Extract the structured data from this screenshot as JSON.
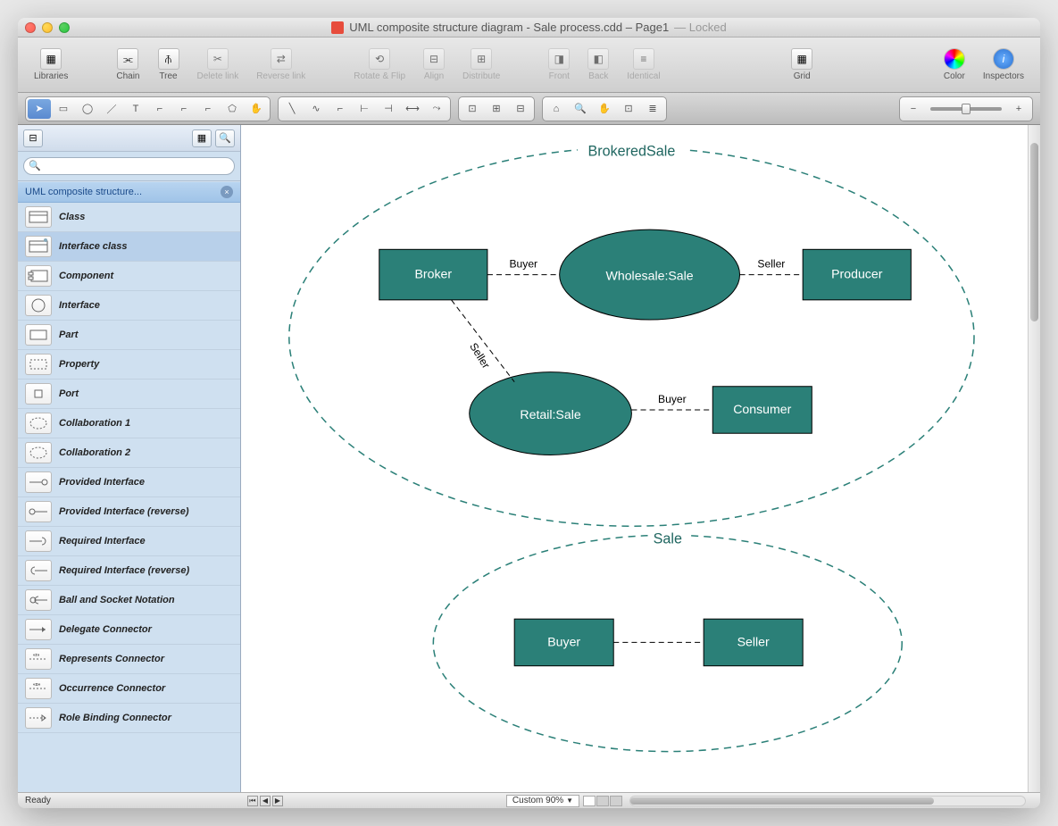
{
  "window": {
    "title": "UML composite structure diagram - Sale process.cdd – Page1",
    "locked_label": "— Locked"
  },
  "toolbar": {
    "libraries": "Libraries",
    "chain": "Chain",
    "tree": "Tree",
    "delete_link": "Delete link",
    "reverse_link": "Reverse link",
    "rotate_flip": "Rotate & Flip",
    "align": "Align",
    "distribute": "Distribute",
    "front": "Front",
    "back": "Back",
    "identical": "Identical",
    "grid": "Grid",
    "color": "Color",
    "inspectors": "Inspectors"
  },
  "sidebar": {
    "search_placeholder": "",
    "library_title": "UML composite structure...",
    "shapes": [
      "Class",
      "Interface class",
      "Component",
      "Interface",
      "Part",
      "Property",
      "Port",
      "Collaboration 1",
      "Collaboration 2",
      "Provided Interface",
      "Provided Interface (reverse)",
      "Required Interface",
      "Required Interface (reverse)",
      "Ball and Socket Notation",
      "Delegate Connector",
      "Represents Connector",
      "Occurrence Connector",
      "Role Binding Connector"
    ]
  },
  "diagram": {
    "collab1": "BrokeredSale",
    "collab2": "Sale",
    "broker": "Broker",
    "wholesale": "Wholesale:Sale",
    "producer": "Producer",
    "retail": "Retail:Sale",
    "consumer": "Consumer",
    "buyer_label": "Buyer",
    "seller_label": "Seller",
    "buyer2": "Buyer",
    "seller2": "Seller"
  },
  "status": {
    "ready": "Ready",
    "zoom": "Custom 90%"
  },
  "colors": {
    "teal": "#2b8078",
    "teal_dark": "#1f6660"
  }
}
